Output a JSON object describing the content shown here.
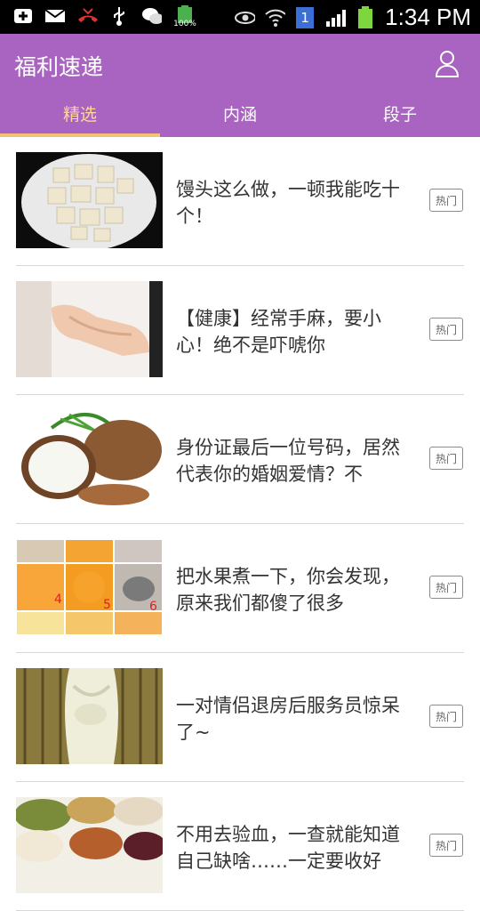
{
  "status_bar": {
    "time": "1:34 PM",
    "battery_text": "100%",
    "sim_slot": "1",
    "icons": [
      "add-icon",
      "mail-icon",
      "missed-call-icon",
      "usb-icon",
      "wechat-icon",
      "battery-icon",
      "eye-icon",
      "wifi-icon",
      "sim-icon",
      "signal-icon",
      "battery-full-icon"
    ]
  },
  "app": {
    "title": "福利速递",
    "tabs": [
      {
        "label": "精选"
      },
      {
        "label": "内涵"
      },
      {
        "label": "段子"
      }
    ]
  },
  "list": {
    "items": [
      {
        "title": "馒头这么做，一顿我能吃十个！",
        "badge": "热门",
        "thumb_icon": "bread-plate-image"
      },
      {
        "title": "【健康】经常手麻，要小心！绝不是吓唬你",
        "badge": "热门",
        "thumb_icon": "hand-wrist-image"
      },
      {
        "title": "身份证最后一位号码，居然代表你的婚姻爱情？不",
        "badge": "热门",
        "thumb_icon": "coconut-image"
      },
      {
        "title": "把水果煮一下，你会发现，原来我们都傻了很多",
        "badge": "热门",
        "thumb_icon": "fruit-steps-image"
      },
      {
        "title": "一对情侣退房后服务员惊呆了~",
        "badge": "热门",
        "thumb_icon": "towel-figure-image"
      },
      {
        "title": "不用去验血，一查就能知道自己缺啥……一定要收好",
        "badge": "热门",
        "thumb_icon": "nuts-image"
      }
    ]
  },
  "colors": {
    "appbar": "#a864c0",
    "active_tab": "#ffd79a",
    "indicator": "#f1c277"
  }
}
